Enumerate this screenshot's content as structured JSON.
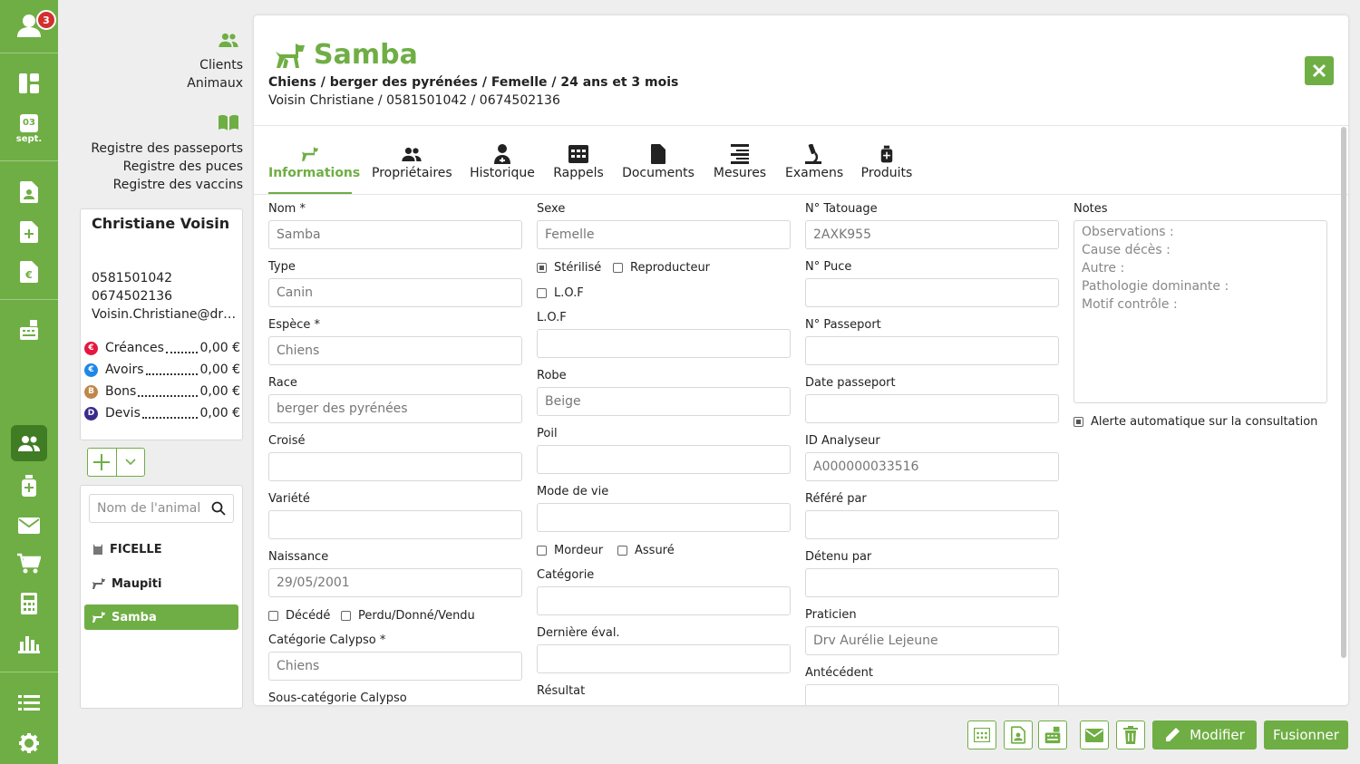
{
  "rail": {
    "user_badge": "3",
    "calendar_day": "03",
    "calendar_month": "sept."
  },
  "nav": {
    "clients": "Clients",
    "animaux": "Animaux",
    "registre_passeports": "Registre des passeports",
    "registre_puces": "Registre des puces",
    "registre_vaccins": "Registre des vaccins"
  },
  "client": {
    "name": "Christiane Voisin",
    "phone1": "0581501042",
    "phone2": "0674502136",
    "email": "Voisin.Christiane@drvet.fr",
    "balances": [
      {
        "badge": "€",
        "label": "Créances",
        "value": "0,00 €",
        "color": "#e5173f"
      },
      {
        "badge": "€",
        "label": "Avoirs",
        "value": "0,00 €",
        "color": "#1e88e5"
      },
      {
        "badge": "B",
        "label": "Bons",
        "value": "0,00 €",
        "color": "#c0874a"
      },
      {
        "badge": "D",
        "label": "Devis",
        "value": "0,00 €",
        "color": "#3a2a8c"
      }
    ]
  },
  "animal_search": {
    "placeholder": "Nom de l'animal"
  },
  "animals": [
    {
      "name": "FICELLE",
      "icon": "cat-icon"
    },
    {
      "name": "Maupiti",
      "icon": "dog-icon"
    },
    {
      "name": "Samba",
      "icon": "dog-icon"
    }
  ],
  "animal": {
    "title": "Samba",
    "subtitle": "Chiens / berger des pyrénées / Femelle / 24 ans et 3 mois",
    "contact": "Voisin Christiane / 0581501042 / 0674502136"
  },
  "tabs": [
    "Informations",
    "Propriétaires",
    "Historique",
    "Rappels",
    "Documents",
    "Mesures",
    "Examens",
    "Produits"
  ],
  "form": {
    "nom": {
      "label": "Nom *",
      "value": "Samba"
    },
    "type": {
      "label": "Type",
      "value": "Canin"
    },
    "espece": {
      "label": "Espèce *",
      "value": "Chiens"
    },
    "race": {
      "label": "Race",
      "value": "berger des pyrénées"
    },
    "croise": {
      "label": "Croisé",
      "value": ""
    },
    "variete": {
      "label": "Variété",
      "value": ""
    },
    "naissance": {
      "label": "Naissance",
      "value": "29/05/2001"
    },
    "decede": "Décédé",
    "perdu": "Perdu/Donné/Vendu",
    "cat_calypso": {
      "label": "Catégorie Calypso *",
      "value": "Chiens"
    },
    "souscat_calypso": "Sous-catégorie Calypso",
    "sexe": {
      "label": "Sexe",
      "value": "Femelle"
    },
    "sterilise": "Stérilisé",
    "reproducteur": "Reproducteur",
    "lof_check": "L.O.F",
    "lof": {
      "label": "L.O.F",
      "value": ""
    },
    "robe": {
      "label": "Robe",
      "value": "Beige"
    },
    "poil": {
      "label": "Poil",
      "value": ""
    },
    "mode_vie": {
      "label": "Mode de vie",
      "value": ""
    },
    "mordeur": "Mordeur",
    "assure": "Assuré",
    "categorie": {
      "label": "Catégorie",
      "value": ""
    },
    "derniere_eval": {
      "label": "Dernière éval.",
      "value": ""
    },
    "resultat": "Résultat",
    "tatouage": {
      "label": "N° Tatouage",
      "value": "2AXK955"
    },
    "puce": {
      "label": "N° Puce",
      "value": ""
    },
    "passeport": {
      "label": "N° Passeport",
      "value": ""
    },
    "date_passeport": {
      "label": "Date passeport",
      "value": ""
    },
    "id_analyseur": {
      "label": "ID Analyseur",
      "value": "A000000033516"
    },
    "refere_par": {
      "label": "Référé par",
      "value": ""
    },
    "detenu_par": {
      "label": "Détenu par",
      "value": ""
    },
    "praticien": {
      "label": "Praticien",
      "value": "Drv Aurélie Lejeune"
    },
    "antecedent": "Antécédent",
    "notes_label": "Notes",
    "notes": [
      "Observations :",
      "Cause décès :",
      "Autre :",
      "Pathologie dominante :",
      "Motif contrôle :"
    ],
    "alerte": "Alerte automatique sur la consultation"
  },
  "footer": {
    "modifier": "Modifier",
    "fusionner": "Fusionner"
  },
  "colors": {
    "accent": "#6fae44",
    "accent_dark": "#3f7c23",
    "badge_red": "#d32f2f"
  }
}
